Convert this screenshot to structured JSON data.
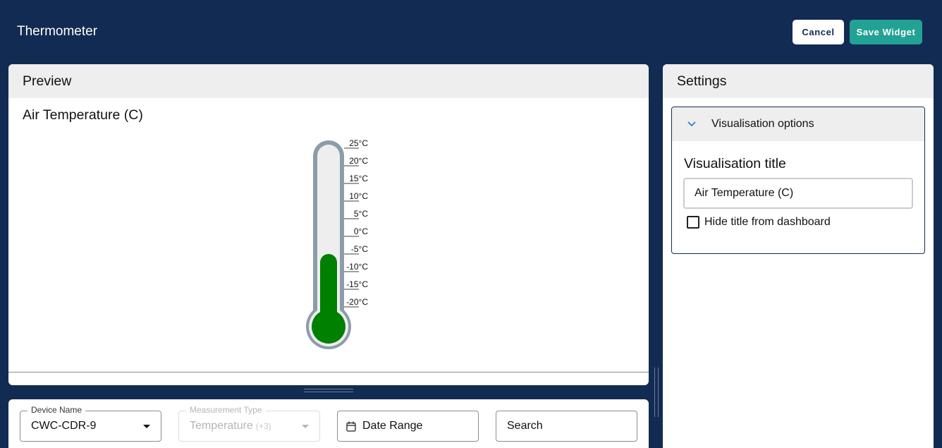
{
  "app": {
    "title": "Thermometer"
  },
  "actions": {
    "cancel_label": "Cancel",
    "save_label": "Save Widget"
  },
  "preview": {
    "header": "Preview",
    "visualisation_title": "Air Temperature (C)",
    "thermometer": {
      "ticks": [
        "25°C",
        "20°C",
        "15°C",
        "10°C",
        "5°C",
        "0°C",
        "-5°C",
        "-10°C",
        "-15°C",
        "-20°C"
      ],
      "min_value": -20,
      "max_value": 25,
      "current_value": -5,
      "fill_color": "#008000",
      "tube_border_color": "#8c9ca8",
      "tube_fill_color": "#eeeeee"
    }
  },
  "settings": {
    "header": "Settings",
    "accordion_title": "Visualisation options",
    "field_label": "Visualisation title",
    "field_value": "Air Temperature (C)",
    "checkbox_label": "Hide title from dashboard",
    "checkbox_checked": false
  },
  "filters": {
    "device": {
      "label": "Device Name",
      "value": "CWC-CDR-9"
    },
    "measurement": {
      "label": "Measurement Type",
      "value": "Temperature",
      "extra": "(+3)"
    },
    "date": {
      "placeholder": "Date Range"
    },
    "search": {
      "placeholder": "Search"
    }
  },
  "colors": {
    "background": "#122b52",
    "accent": "#22a295"
  }
}
